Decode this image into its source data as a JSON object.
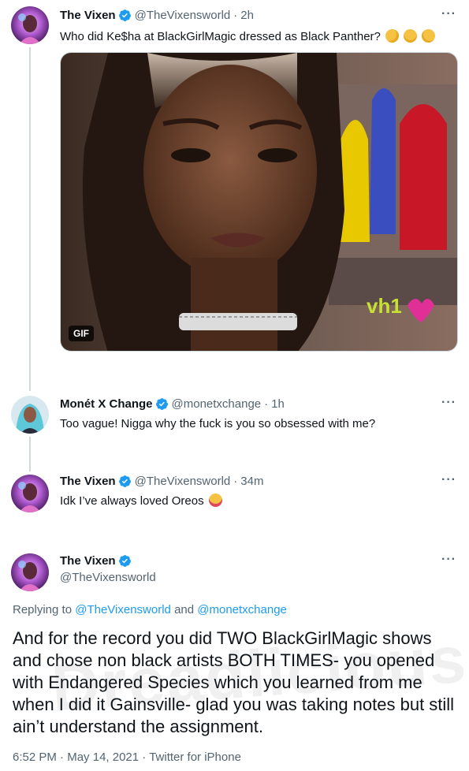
{
  "tweets": [
    {
      "name": "The Vixen",
      "handle": "@TheVixensworld",
      "time": "2h",
      "text": "Who did Ke$ha at BlackGirlMagic dressed as Black Panther?",
      "media_badge": "GIF",
      "media_watermark": "vh1"
    },
    {
      "name": "Monét X Change",
      "handle": "@monetxchange",
      "time": "1h",
      "text": "Too vague! Nigga why the fuck is you so obsessed with me?"
    },
    {
      "name": "The Vixen",
      "handle": "@TheVixensworld",
      "time": "34m",
      "text": "Idk I’ve always loved Oreos"
    }
  ],
  "main_tweet": {
    "name": "The Vixen",
    "handle": "@TheVixensworld",
    "replying_prefix": "Replying to",
    "replying_to_1": "@TheVixensworld",
    "replying_and": "and",
    "replying_to_2": "@monetxchange",
    "text": "And for the record you did TWO BlackGirlMagic shows and chose non black artists BOTH TIMES- you opened with Endangered Species which you learned from me when I did it Gainsville- glad you was taking notes but still ain’t understand the assignment.",
    "time": "6:52 PM",
    "date": "May 14, 2021",
    "source": "Twitter for iPhone",
    "watermark": "Dreadlicious"
  },
  "ui": {
    "separator": "·",
    "more": "···"
  },
  "colors": {
    "verified": "#1d9bf0",
    "link": "#1d9bf0",
    "secondary": "#536471",
    "thread_line": "#cfd9de"
  }
}
